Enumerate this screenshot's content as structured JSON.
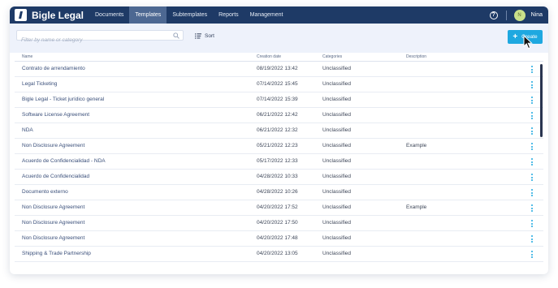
{
  "app": {
    "name": "Bigle Legal"
  },
  "nav": {
    "items": [
      {
        "label": "Documents",
        "active": false
      },
      {
        "label": "Templates",
        "active": true
      },
      {
        "label": "Subtemplates",
        "active": false
      },
      {
        "label": "Reports",
        "active": false
      },
      {
        "label": "Management",
        "active": false
      }
    ]
  },
  "user": {
    "initial": "N",
    "name": "Nina"
  },
  "toolbar": {
    "search_placeholder": "Filter by name or category",
    "sort_label": "Sort",
    "create_label": "Create"
  },
  "table": {
    "columns": [
      "Name",
      "Creation date",
      "Categories",
      "Description"
    ],
    "rows": [
      {
        "name": "Contrato de arrendamiento",
        "date": "08/19/2022 13:42",
        "category": "Unclassified",
        "description": ""
      },
      {
        "name": "Legal Ticketing",
        "date": "07/14/2022 15:45",
        "category": "Unclassified",
        "description": ""
      },
      {
        "name": "Bigle Legal - Ticket jurídico general",
        "date": "07/14/2022 15:39",
        "category": "Unclassified",
        "description": ""
      },
      {
        "name": "Software License Agreement",
        "date": "06/21/2022 12:42",
        "category": "Unclassified",
        "description": ""
      },
      {
        "name": "NDA",
        "date": "06/21/2022 12:32",
        "category": "Unclassified",
        "description": ""
      },
      {
        "name": "Non Disclosure Agreement",
        "date": "05/21/2022 12:23",
        "category": "Unclassified",
        "description": "Example"
      },
      {
        "name": "Acuerdo de Confidencialidad - NDA",
        "date": "05/17/2022 12:33",
        "category": "Unclassified",
        "description": ""
      },
      {
        "name": "Acuerdo de Confidencialidad",
        "date": "04/28/2022 10:33",
        "category": "Unclassified",
        "description": ""
      },
      {
        "name": "Documento externo",
        "date": "04/28/2022 10:26",
        "category": "Unclassified",
        "description": ""
      },
      {
        "name": "Non Disclosure Agreement",
        "date": "04/20/2022 17:52",
        "category": "Unclassified",
        "description": "Example"
      },
      {
        "name": "Non Disclosure Agreement",
        "date": "04/20/2022 17:50",
        "category": "Unclassified",
        "description": ""
      },
      {
        "name": "Non Disclosure Agreement",
        "date": "04/20/2022 17:48",
        "category": "Unclassified",
        "description": ""
      },
      {
        "name": "Shipping & Trade Partnership",
        "date": "04/20/2022 13:05",
        "category": "Unclassified",
        "description": ""
      }
    ]
  },
  "colors": {
    "topbar": "#1e3a66",
    "active_tab": "#4d6892",
    "accent": "#1ea8e0",
    "toolbar_bg": "#eef2fb"
  }
}
